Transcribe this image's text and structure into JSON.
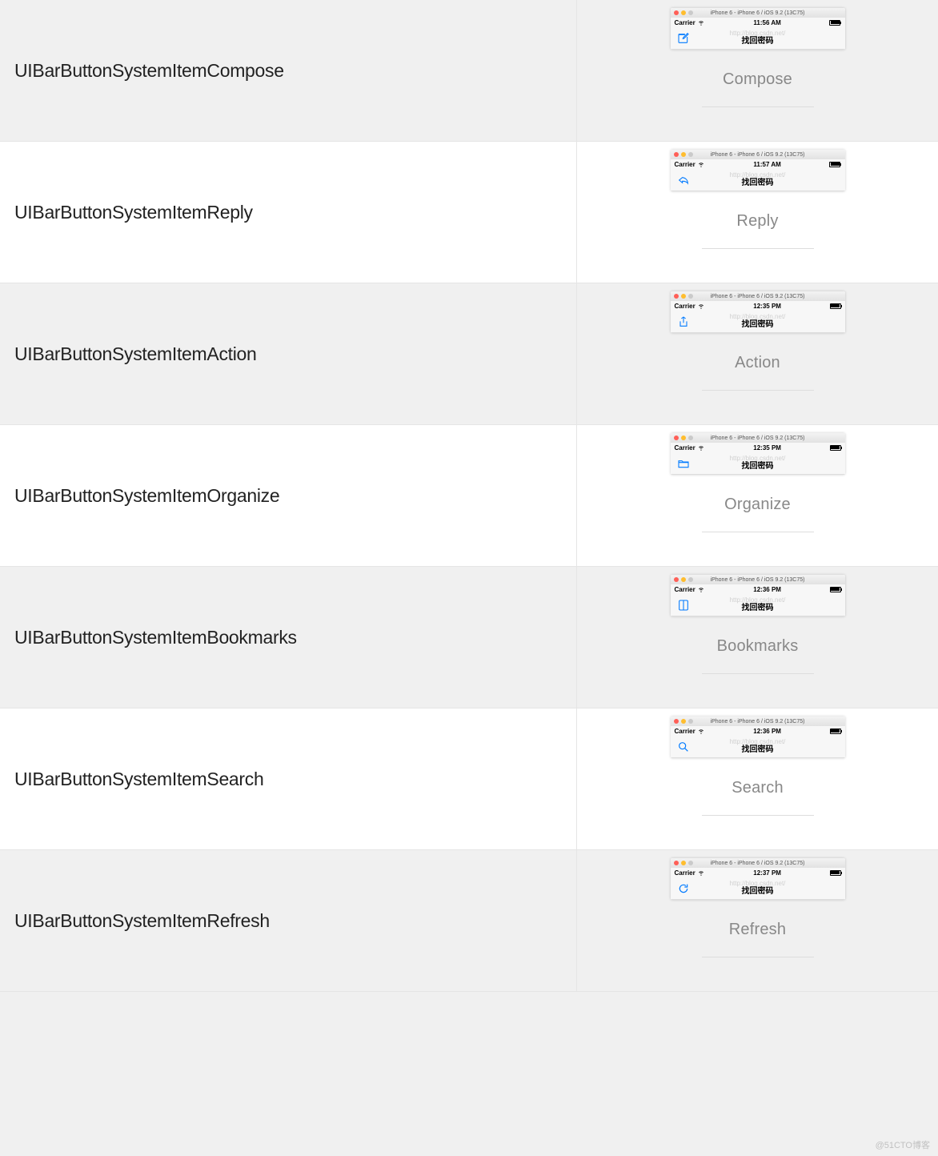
{
  "rows": [
    {
      "bg": "alt",
      "label": "UIBarButtonSystemItemCompose",
      "caption": "Compose",
      "time": "11:56 AM",
      "icon": "compose"
    },
    {
      "bg": "norm",
      "label": "UIBarButtonSystemItemReply",
      "caption": "Reply",
      "time": "11:57 AM",
      "icon": "reply"
    },
    {
      "bg": "alt",
      "label": "UIBarButtonSystemItemAction",
      "caption": "Action",
      "time": "12:35 PM",
      "icon": "action"
    },
    {
      "bg": "norm",
      "label": "UIBarButtonSystemItemOrganize",
      "caption": "Organize",
      "time": "12:35 PM",
      "icon": "organize"
    },
    {
      "bg": "alt",
      "label": "UIBarButtonSystemItemBookmarks",
      "caption": "Bookmarks",
      "time": "12:36 PM",
      "icon": "bookmarks"
    },
    {
      "bg": "norm",
      "label": "UIBarButtonSystemItemSearch",
      "caption": "Search",
      "time": "12:36 PM",
      "icon": "search"
    },
    {
      "bg": "alt",
      "label": "UIBarButtonSystemItemRefresh",
      "caption": "Refresh",
      "time": "12:37 PM",
      "icon": "refresh"
    }
  ],
  "sim": {
    "window_title": "iPhone 6 - iPhone 6 / iOS 9.2 (13C75)",
    "carrier": "Carrier",
    "nav_title": "找回密码",
    "watermark": "http://blog.csdn.net/"
  },
  "footer": "@51CTO博客"
}
